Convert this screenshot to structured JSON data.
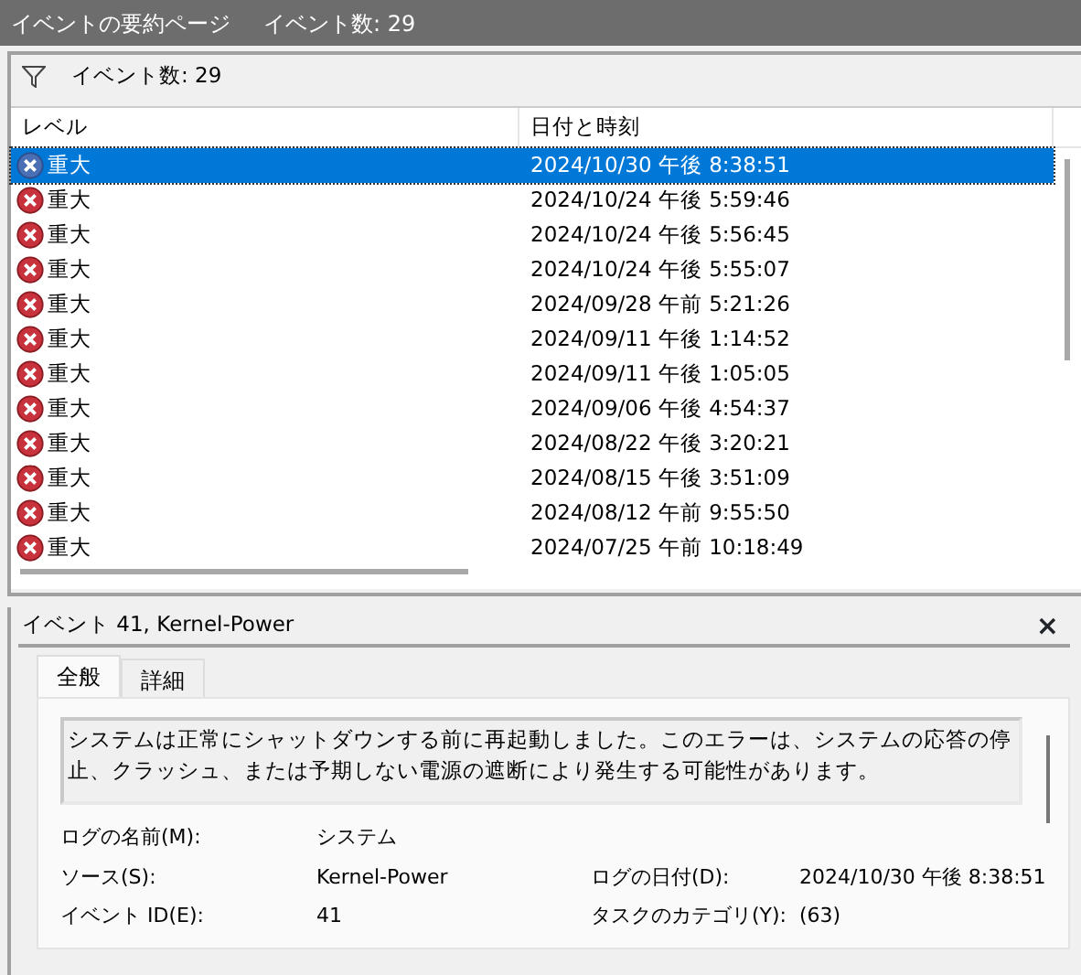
{
  "window": {
    "title": "イベントの要約ページ",
    "count": "イベント数: 29"
  },
  "toolbar": {
    "count": "イベント数: 29"
  },
  "table": {
    "columns": [
      "レベル",
      "日付と時刻"
    ],
    "rows": [
      {
        "level": "重大",
        "date": "2024/10/30 午後 8:38:51",
        "selected": true
      },
      {
        "level": "重大",
        "date": "2024/10/24 午後 5:59:46",
        "selected": false
      },
      {
        "level": "重大",
        "date": "2024/10/24 午後 5:56:45",
        "selected": false
      },
      {
        "level": "重大",
        "date": "2024/10/24 午後 5:55:07",
        "selected": false
      },
      {
        "level": "重大",
        "date": "2024/09/28 午前 5:21:26",
        "selected": false
      },
      {
        "level": "重大",
        "date": "2024/09/11 午後 1:14:52",
        "selected": false
      },
      {
        "level": "重大",
        "date": "2024/09/11 午後 1:05:05",
        "selected": false
      },
      {
        "level": "重大",
        "date": "2024/09/06 午後 4:54:37",
        "selected": false
      },
      {
        "level": "重大",
        "date": "2024/08/22 午後 3:20:21",
        "selected": false
      },
      {
        "level": "重大",
        "date": "2024/08/15 午後 3:51:09",
        "selected": false
      },
      {
        "level": "重大",
        "date": "2024/08/12 午前 9:55:50",
        "selected": false
      },
      {
        "level": "重大",
        "date": "2024/07/25 午前 10:18:49",
        "selected": false
      }
    ]
  },
  "detail": {
    "title": "イベント 41, Kernel-Power",
    "close": "×",
    "tabs": [
      {
        "label": "全般",
        "selected": true
      },
      {
        "label": "詳細",
        "selected": false
      }
    ],
    "message": "システムは正常にシャットダウンする前に再起動しました。このエラーは、システムの応答の停止、クラッシュ、または予期しない電源の遮断により発生する可能性があります。",
    "fields": [
      {
        "label": "ログの名前(M):",
        "value": "システム"
      },
      {
        "label": "ソース(S):",
        "value": "Kernel-Power",
        "label2": "ログの日付(D):",
        "value2": "2024/10/30 午後 8:38:51"
      },
      {
        "label": "イベント ID(E):",
        "value": "41",
        "label2": "タスクのカテゴリ(Y):",
        "value2": "(63)"
      }
    ]
  }
}
